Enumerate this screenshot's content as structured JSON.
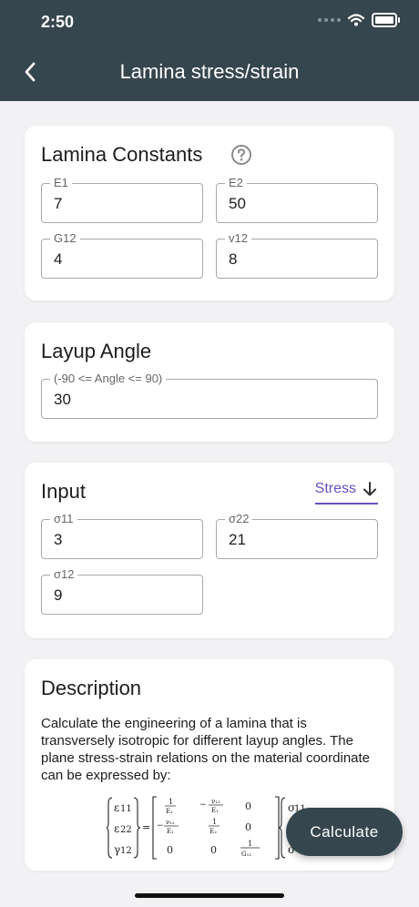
{
  "status": {
    "time": "2:50"
  },
  "header": {
    "title": "Lamina stress/strain"
  },
  "constants": {
    "title": "Lamina Constants",
    "fields": [
      {
        "label": "E1",
        "value": "7"
      },
      {
        "label": "E2",
        "value": "50"
      },
      {
        "label": "G12",
        "value": "4"
      },
      {
        "label": "v12",
        "value": "8"
      }
    ]
  },
  "layup": {
    "title": "Layup Angle",
    "label": "(-90 <= Angle <= 90)",
    "value": "30"
  },
  "input": {
    "title": "Input",
    "mode_label": "Stress",
    "fields": [
      {
        "label": "σ11",
        "value": "3"
      },
      {
        "label": "σ22",
        "value": "21"
      },
      {
        "label": "σ12",
        "value": "9"
      }
    ]
  },
  "description": {
    "title": "Description",
    "text": "Calculate the engineering of a lamina that is transversely isotropic for different layup angles. The plane stress-strain relations on the material coordinate can be expressed by:"
  },
  "actions": {
    "calculate_label": "Calculate"
  },
  "icons": {
    "back": "back-chevron-icon",
    "help": "help-circle-icon",
    "toggle": "arrow-down-icon",
    "wifi": "wifi-icon",
    "battery": "battery-icon"
  },
  "colors": {
    "appbar": "#36464f",
    "accent": "#6a4fc0",
    "background": "#f2f2f4"
  }
}
